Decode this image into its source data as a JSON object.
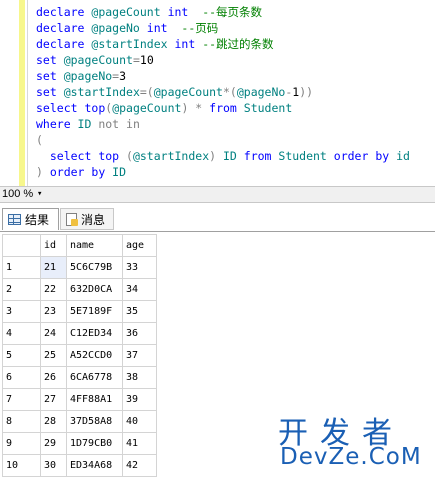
{
  "editor": {
    "lines": [
      [
        {
          "t": "declare ",
          "c": "kw"
        },
        {
          "t": "@pageCount ",
          "c": "var"
        },
        {
          "t": "int",
          "c": "kw"
        },
        {
          "t": "  --每页条数",
          "c": "cm"
        }
      ],
      [
        {
          "t": "declare ",
          "c": "kw"
        },
        {
          "t": "@pageNo ",
          "c": "var"
        },
        {
          "t": "int",
          "c": "kw"
        },
        {
          "t": "  --页码",
          "c": "cm"
        }
      ],
      [
        {
          "t": "declare ",
          "c": "kw"
        },
        {
          "t": "@startIndex ",
          "c": "var"
        },
        {
          "t": "int ",
          "c": "kw"
        },
        {
          "t": "--跳过的条数",
          "c": "cm"
        }
      ],
      [
        {
          "t": "set ",
          "c": "kw"
        },
        {
          "t": "@pageCount",
          "c": "var"
        },
        {
          "t": "=",
          "c": "gr"
        },
        {
          "t": "10",
          "c": ""
        }
      ],
      [
        {
          "t": "set ",
          "c": "kw"
        },
        {
          "t": "@pageNo",
          "c": "var"
        },
        {
          "t": "=",
          "c": "gr"
        },
        {
          "t": "3",
          "c": ""
        }
      ],
      [
        {
          "t": "set ",
          "c": "kw"
        },
        {
          "t": "@startIndex",
          "c": "var"
        },
        {
          "t": "=(",
          "c": "gr"
        },
        {
          "t": "@pageCount",
          "c": "var"
        },
        {
          "t": "*(",
          "c": "gr"
        },
        {
          "t": "@pageNo",
          "c": "var"
        },
        {
          "t": "-",
          "c": "gr"
        },
        {
          "t": "1",
          "c": ""
        },
        {
          "t": "))",
          "c": "gr"
        }
      ],
      [
        {
          "t": "select ",
          "c": "kw"
        },
        {
          "t": "top",
          "c": "kw"
        },
        {
          "t": "(",
          "c": "gr"
        },
        {
          "t": "@pageCount",
          "c": "var"
        },
        {
          "t": ") ",
          "c": "gr"
        },
        {
          "t": "* ",
          "c": "gr"
        },
        {
          "t": "from ",
          "c": "kw"
        },
        {
          "t": "Student",
          "c": "obj"
        }
      ],
      [
        {
          "t": "where ",
          "c": "kw"
        },
        {
          "t": "ID ",
          "c": "var"
        },
        {
          "t": "not in",
          "c": "gr"
        }
      ],
      [
        {
          "t": "(",
          "c": "gr"
        }
      ],
      [
        {
          "t": "  select ",
          "c": "kw"
        },
        {
          "t": "top ",
          "c": "kw"
        },
        {
          "t": "(",
          "c": "gr"
        },
        {
          "t": "@startIndex",
          "c": "var"
        },
        {
          "t": ") ",
          "c": "gr"
        },
        {
          "t": "ID ",
          "c": "var"
        },
        {
          "t": "from ",
          "c": "kw"
        },
        {
          "t": "Student ",
          "c": "obj"
        },
        {
          "t": "order by ",
          "c": "kw"
        },
        {
          "t": "id",
          "c": "var"
        }
      ],
      [
        {
          "t": ") ",
          "c": "gr"
        },
        {
          "t": "order by ",
          "c": "kw"
        },
        {
          "t": "ID",
          "c": "var"
        }
      ]
    ]
  },
  "zoom": {
    "value": "100 %"
  },
  "tabs": {
    "results": "结果",
    "messages": "消息"
  },
  "grid": {
    "columns": [
      "id",
      "name",
      "age"
    ],
    "rows": [
      {
        "n": "1",
        "id": "21",
        "name": "5C6C79B",
        "age": "33"
      },
      {
        "n": "2",
        "id": "22",
        "name": "632D0CA",
        "age": "34"
      },
      {
        "n": "3",
        "id": "23",
        "name": "5E7189F",
        "age": "35"
      },
      {
        "n": "4",
        "id": "24",
        "name": "C12ED34",
        "age": "36"
      },
      {
        "n": "5",
        "id": "25",
        "name": "A52CCD0",
        "age": "37"
      },
      {
        "n": "6",
        "id": "26",
        "name": "6CA6778",
        "age": "38"
      },
      {
        "n": "7",
        "id": "27",
        "name": "4FF88A1",
        "age": "39"
      },
      {
        "n": "8",
        "id": "28",
        "name": "37D58A8",
        "age": "40"
      },
      {
        "n": "9",
        "id": "29",
        "name": "1D79CB0",
        "age": "41"
      },
      {
        "n": "10",
        "id": "30",
        "name": "ED34A68",
        "age": "42"
      }
    ]
  },
  "watermark": {
    "cn": "开发者",
    "en": "DevZe.CoM"
  }
}
